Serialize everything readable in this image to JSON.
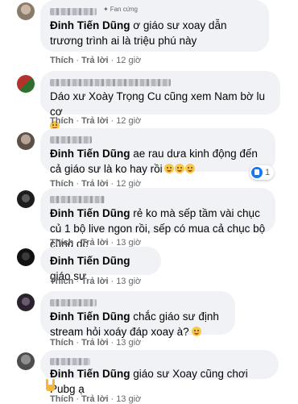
{
  "comments": [
    {
      "badge": "Fan cứng",
      "mention": "Đinh Tiến Dũng",
      "text": " ơ giáo sư xoay dẫn trương trình ai là triệu phú này",
      "like": "Thích",
      "reply": "Trả lời",
      "time": "12 giờ"
    },
    {
      "text": "Dáo xư Xoày Trọng Cu cũng xem Nam bờ lu cơ",
      "like": "Thích",
      "reply": "Trả lời",
      "time": "12 giờ"
    },
    {
      "mention": "Đinh Tiến Dũng",
      "text": " ae rau dưa kinh động đến cả giáo sư là ko hay rồi",
      "like": "Thích",
      "reply": "Trả lời",
      "time": "12 giờ",
      "reaction_count": "1"
    },
    {
      "mention": "Đinh Tiến Dũng",
      "text": " rẻ ko mà sếp tầm vài chục củ 1 bộ live ngon rồi, sếp có mua cả chục bộ cũng dc",
      "like": "Thích",
      "reply": "Trả lời",
      "time": "13 giờ"
    },
    {
      "mention": "Đinh Tiến Dũng",
      "text": " giáo sư",
      "like": "Thích",
      "reply": "Trả lời",
      "time": "13 giờ"
    },
    {
      "mention": "Đinh Tiến Dũng",
      "text": " chắc giáo sư định stream hỏi xoáy đáp xoay à?",
      "like": "Thích",
      "reply": "Trả lời",
      "time": "13 giờ"
    },
    {
      "mention": "Đinh Tiến Dũng",
      "text": " giáo sư Xoay cũng chơi Pubg ạ",
      "like": "Thích",
      "reply": "Trả lời",
      "time": "13 giờ"
    }
  ],
  "icons": {
    "like_reaction": "like-icon",
    "laugh": "laughing-emoji",
    "rocker": "rock-hand-emoji"
  },
  "colors": {
    "bubble": "#f0f2f5",
    "like_blue": "#1877f2",
    "meta_text": "#65676b"
  }
}
